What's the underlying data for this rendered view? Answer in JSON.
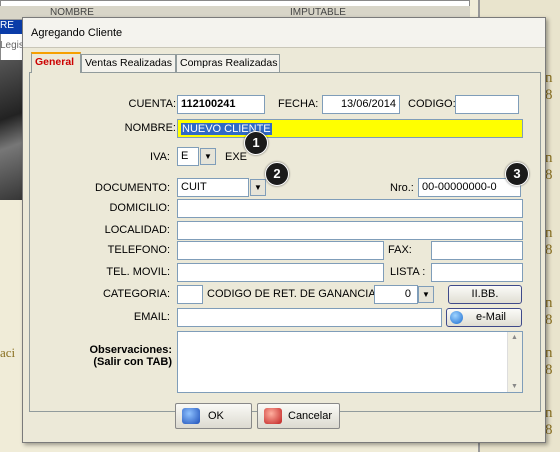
{
  "background": {
    "grid_header": [
      "NOMBRE",
      "IMPUTABLE"
    ],
    "blue_cell": "RE",
    "legis_text": "Legis",
    "side_letters": [
      "n 8",
      "n 8",
      "n 8",
      "n 8",
      "n 8",
      "n 8"
    ],
    "left_text": "aci"
  },
  "dialog": {
    "title": "Agregando Cliente",
    "tabs": [
      "General",
      "Ventas Realizadas",
      "Compras Realizadas"
    ],
    "active_tab": "General"
  },
  "form": {
    "cuenta_label": "CUENTA:",
    "cuenta_value": "112100241",
    "fecha_label": "FECHA:",
    "fecha_value": "13/06/2014",
    "codigo_label": "CODIGO:",
    "codigo_value": "",
    "nombre_label": "NOMBRE:",
    "nombre_value": "NUEVO CLIENTE",
    "iva_label": "IVA:",
    "iva_value": "E",
    "iva_desc": "EXE",
    "documento_label": "DOCUMENTO:",
    "documento_value": "CUIT",
    "nro_label": "Nro.:",
    "nro_value": "00-00000000-0",
    "domicilio_label": "DOMICILIO:",
    "localidad_label": "LOCALIDAD:",
    "telefono_label": "TELEFONO:",
    "fax_label": "FAX:",
    "movil_label": "TEL. MOVIL:",
    "lista_label": "LISTA :",
    "categoria_label": "CATEGORIA:",
    "ret_label": "CODIGO DE RET. DE GANANCIAS:",
    "ret_value": "0",
    "iibb_label": "II.BB.",
    "email_label": "EMAIL:",
    "email_button": "e-Mail",
    "obs_label_1": "Observaciones:",
    "obs_label_2": "(Salir con TAB)"
  },
  "buttons": {
    "ok": "OK",
    "cancel": "Cancelar"
  },
  "badges": [
    "1",
    "2",
    "3"
  ],
  "colors": {
    "active_tab_text": "#cc0000",
    "name_field": "#ffff00",
    "selection": "#316ac5"
  }
}
